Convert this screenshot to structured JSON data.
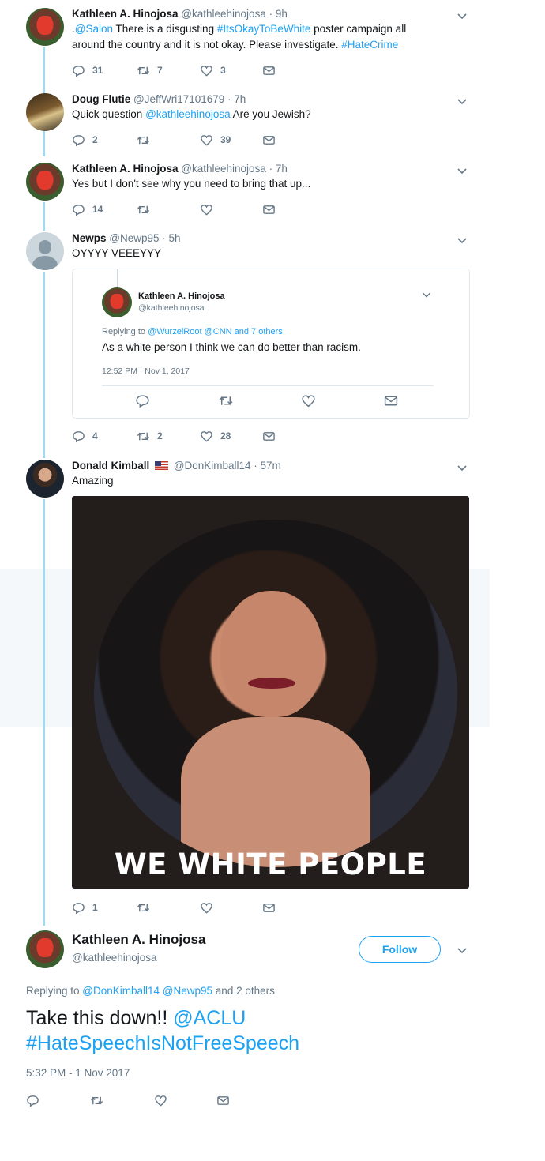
{
  "thread": [
    {
      "name": "Kathleen A. Hinojosa",
      "handle_time": "@kathleehinojosa · 9h",
      "parts": [
        ".",
        "@Salon",
        " There is a disgusting ",
        "#ItsOkayToBeWhite",
        " poster campaign all around the country and it is not okay. Please investigate. ",
        "#HateCrime"
      ],
      "replies": "31",
      "retweets": "7",
      "likes": "3"
    },
    {
      "name": "Doug Flutie",
      "handle_time": "@JeffWri17101679 · 7h",
      "parts": [
        "Quick question ",
        "@kathleehinojosa",
        " Are you Jewish?"
      ],
      "replies": "2",
      "retweets": "",
      "likes": "39"
    },
    {
      "name": "Kathleen A. Hinojosa",
      "handle_time": "@kathleehinojosa · 7h",
      "parts": [
        "Yes but I don't see why you need to bring that up..."
      ],
      "replies": "14",
      "retweets": "",
      "likes": ""
    },
    {
      "name": "Newps",
      "handle_time": "@Newp95 · 5h",
      "parts": [
        "OYYYY VEEEYYY"
      ],
      "replies": "4",
      "retweets": "2",
      "likes": "28",
      "quote": {
        "name": "Kathleen A. Hinojosa",
        "handle": "@kathleehinojosa",
        "replying_prefix": "Replying to ",
        "replying_links": "@WurzelRoot @CNN and 7 others",
        "text": "As a white person I think we can do better than racism.",
        "time": "12:52 PM · Nov 1, 2017"
      }
    },
    {
      "name": "Donald Kimball",
      "handle_time": "@DonKimball14 · 57m",
      "parts": [
        "Amazing"
      ],
      "replies": "1",
      "retweets": "",
      "likes": "",
      "meme_text": "WE WHITE PEOPLE"
    }
  ],
  "main": {
    "name": "Kathleen A. Hinojosa",
    "handle": "@kathleehinojosa",
    "follow_label": "Follow",
    "replying_prefix": "Replying to ",
    "replying_links": "@DonKimball14 @Newp95",
    "replying_suffix": " and 2 others",
    "text_plain": "Take this down!! ",
    "text_link1": "@ACLU",
    "text_link2": "#HateSpeechIsNotFreeSpeech",
    "time": "5:32 PM - 1 Nov 2017"
  },
  "colors": {
    "link": "#1da1f2",
    "thread_line": "#a3d7f4",
    "muted": "#657786"
  }
}
